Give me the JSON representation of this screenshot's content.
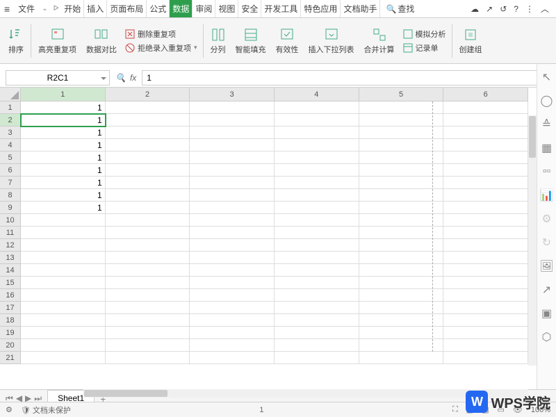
{
  "topbar": {
    "file": "文件",
    "tabs": [
      "开始",
      "插入",
      "页面布局",
      "公式",
      "数据",
      "审阅",
      "视图",
      "安全",
      "开发工具",
      "特色应用",
      "文档助手"
    ],
    "active_tab": 4,
    "search": "查找"
  },
  "ribbon": {
    "sort": "排序",
    "highlight": "高亮重复项",
    "compare": "数据对比",
    "del_dup": "删除重复项",
    "reject_dup": "拒绝录入重复项",
    "split": "分列",
    "fill": "智能填充",
    "validity": "有效性",
    "dropdown": "插入下拉列表",
    "consolidate": "合并计算",
    "analysis": "模拟分析",
    "record": "记录单",
    "group": "创建组"
  },
  "namebox": "R2C1",
  "fx_value": "1",
  "columns": [
    "1",
    "2",
    "3",
    "4",
    "5",
    "6"
  ],
  "rows": [
    "1",
    "2",
    "3",
    "4",
    "5",
    "6",
    "7",
    "8",
    "9",
    "10",
    "11",
    "12",
    "13",
    "14",
    "15",
    "16",
    "17",
    "18",
    "19",
    "20",
    "21"
  ],
  "selected": {
    "row": 1,
    "col": 0
  },
  "cells": [
    [
      "1",
      "",
      "",
      "",
      "",
      ""
    ],
    [
      "1",
      "",
      "",
      "",
      "",
      ""
    ],
    [
      "1",
      "",
      "",
      "",
      "",
      ""
    ],
    [
      "1",
      "",
      "",
      "",
      "",
      ""
    ],
    [
      "1",
      "",
      "",
      "",
      "",
      ""
    ],
    [
      "1",
      "",
      "",
      "",
      "",
      ""
    ],
    [
      "1",
      "",
      "",
      "",
      "",
      ""
    ],
    [
      "1",
      "",
      "",
      "",
      "",
      ""
    ],
    [
      "1",
      "",
      "",
      "",
      "",
      ""
    ],
    [
      "",
      "",
      "",
      "",
      "",
      ""
    ],
    [
      "",
      "",
      "",
      "",
      "",
      ""
    ],
    [
      "",
      "",
      "",
      "",
      "",
      ""
    ],
    [
      "",
      "",
      "",
      "",
      "",
      ""
    ],
    [
      "",
      "",
      "",
      "",
      "",
      ""
    ],
    [
      "",
      "",
      "",
      "",
      "",
      ""
    ],
    [
      "",
      "",
      "",
      "",
      "",
      ""
    ],
    [
      "",
      "",
      "",
      "",
      "",
      ""
    ],
    [
      "",
      "",
      "",
      "",
      "",
      ""
    ],
    [
      "",
      "",
      "",
      "",
      "",
      ""
    ],
    [
      "",
      "",
      "",
      "",
      "",
      ""
    ],
    [
      "",
      "",
      "",
      "",
      "",
      ""
    ]
  ],
  "sheet": "Sheet1",
  "status": {
    "protect": "文档未保护",
    "value": "1",
    "zoom": "100%"
  },
  "logo": "WPS学院"
}
